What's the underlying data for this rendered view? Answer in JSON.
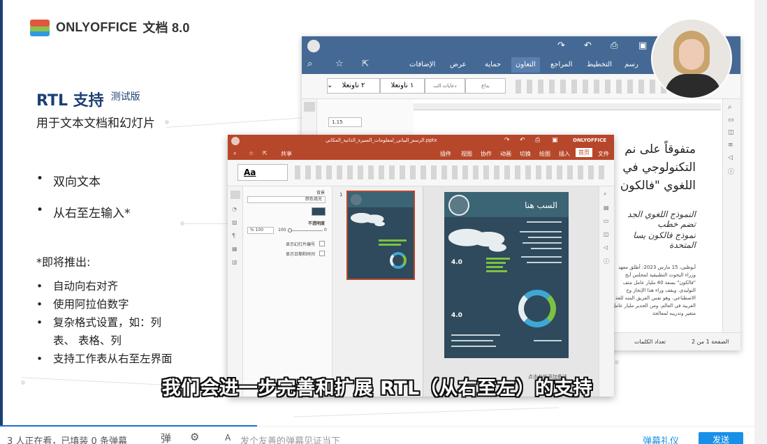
{
  "logo": {
    "brand": "ONLYOFFICE",
    "version": "文档 8.0",
    "colors": [
      "#e2573f",
      "#8bc34a",
      "#2f9ae0",
      "#f2b400"
    ]
  },
  "heading": {
    "title": "RTL 支持",
    "beta": "测试版",
    "subtitle": "用于文本文档和幻灯片"
  },
  "features": [
    "双向文本",
    "从右至左输入*"
  ],
  "coming_soon": {
    "title": "*即将推出:",
    "items": [
      "自动向右对齐",
      "使用阿拉伯数字",
      "复杂格式设置，如：列",
      "表、 表格、列",
      "支持工作表从右至左界面"
    ]
  },
  "doc_window": {
    "tabs": [
      "رسم",
      "التخطيط",
      "المراجع",
      "التعاون",
      "حماية",
      "عرض",
      "الإضافات"
    ],
    "active_tab": "التعاون",
    "style_1": "١ ناونعلا",
    "style_2": "٢ ناونعلا",
    "style_3": "دعايات الب",
    "style_4": "بداع",
    "spacing_value": "1.15",
    "heading_lines": [
      "متفوقاً على نم",
      "التكنولوجي في",
      "اللغوي \"فالكون"
    ],
    "bullets": [
      "النموذج اللغوي الجد",
      "تضم خطب",
      "نموذج فالكون يسا",
      "المتحدة"
    ],
    "paragraph": "أبوظبي، 15 مارس 2023: أطلق معهد وزراء البحوث التطبيقية لمجلس أبح \"فالكون\" بسعة 40 مليار عامل متف التوليدي. ويقف وراء هذا الإنجاز وخ الاصطناعي. وهو نفس الفريق المنه للغة العربية في العالم. ومن الجدير مليار عامل متغير وتدريبه لمعالجة",
    "status_page": "الصفحة 1 من 2",
    "status_words": "تعداد الكلمات",
    "accent": "#446995"
  },
  "pres_window": {
    "title": "الرسم_البياني_لمعلومات_السيرة_الذاتية_المكاني.pptx",
    "brand": "ONLYOFFICE",
    "tabs": [
      "文件",
      "首页",
      "插入",
      "绘图",
      "切换",
      "动画",
      "协作",
      "视图",
      "插件"
    ],
    "active_tab": "首页",
    "share_label": "共享",
    "font_sample": "Aa",
    "panel": {
      "background": "背景",
      "fill": "颜色填充",
      "opacity": "不透明度",
      "opacity_value": "% 100",
      "opacity_max": "100",
      "opacity_min": "0",
      "show_slide_number": "显示幻灯片编号",
      "show_date": "显示日期和时间"
    },
    "slide_heading": "السب هنا",
    "slide_kpi": "4.0",
    "thumb_number": "1",
    "canvas_note": "点击此处添加备注",
    "accent": "#b7472a"
  },
  "caption": "我们会进一步完善和扩展 RTL（从右至左）的支持",
  "player": {
    "left_text": "3 人正在看，已填装 0 条弹幕",
    "input_placeholder": "发个友善的弹幕见证当下",
    "right_text": "弹幕礼仪",
    "send_label": "发送"
  }
}
